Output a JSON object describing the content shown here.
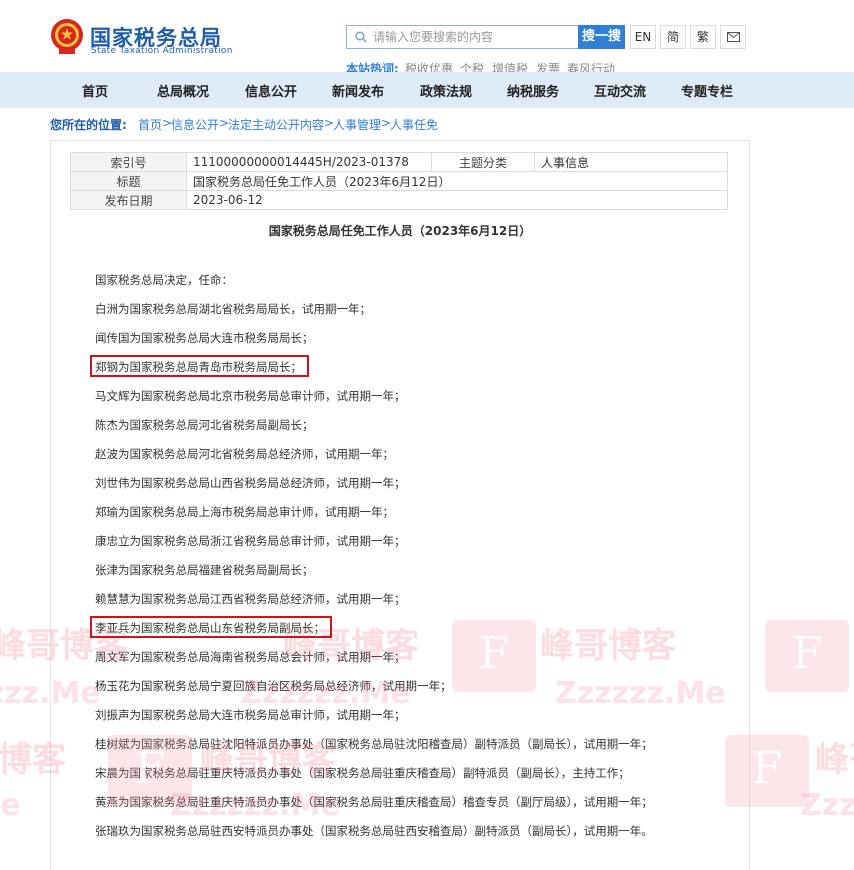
{
  "header": {
    "site_name_cn": "国家税务总局",
    "site_name_en": "State Taxation Administration",
    "search_placeholder": "请输入您要搜索的内容",
    "search_button": "搜一搜",
    "lang_buttons": [
      "EN",
      "简",
      "繁"
    ],
    "mail_icon": "mail-icon",
    "hot_label": "本站热词:",
    "hot_words": [
      "税收优惠",
      "个税",
      "增值税",
      "发票",
      "春风行动"
    ]
  },
  "nav": [
    "首页",
    "总局概况",
    "信息公开",
    "新闻发布",
    "政策法规",
    "纳税服务",
    "互动交流",
    "专题专栏"
  ],
  "breadcrumb": {
    "label": "您所在的位置:",
    "items": [
      "首页",
      "信息公开",
      "法定主动公开内容",
      "人事管理",
      "人事任免"
    ]
  },
  "meta": {
    "index_label": "索引号",
    "index_value": "11100000000014445H/2023-01378",
    "topic_label": "主题分类",
    "topic_value": "人事信息",
    "title_label": "标题",
    "title_value": "国家税务总局任免工作人员（2023年6月12日）",
    "date_label": "发布日期",
    "date_value": "2023-06-12"
  },
  "doc_title": "国家税务总局任免工作人员（2023年6月12日）",
  "paragraphs": [
    "国家税务总局决定，任命：",
    "白洲为国家税务总局湖北省税务局局长，试用期一年；",
    "闻传国为国家税务总局大连市税务局局长；",
    "郑钢为国家税务总局青岛市税务局局长；",
    "马文辉为国家税务总局北京市税务局总审计师，试用期一年；",
    "陈杰为国家税务总局河北省税务局副局长；",
    "赵波为国家税务总局河北省税务局总经济师，试用期一年；",
    "刘世伟为国家税务总局山西省税务局总经济师，试用期一年；",
    "郑瑜为国家税务总局上海市税务局总审计师，试用期一年；",
    "康忠立为国家税务总局浙江省税务局总审计师，试用期一年；",
    "张津为国家税务总局福建省税务局副局长；",
    "赖慧慧为国家税务总局江西省税务局总经济师，试用期一年；",
    "李亚兵为国家税务总局山东省税务局副局长；",
    "周文军为国家税务总局海南省税务局总会计师，试用期一年；",
    "杨玉花为国家税务总局宁夏回族自治区税务局总经济师，试用期一年；",
    "刘振声为国家税务总局大连市税务局总审计师，试用期一年；",
    "桂树斌为国家税务总局驻沈阳特派员办事处（国家税务总局驻沈阳稽查局）副特派员（副局长），试用期一年；",
    "宋晨为国家税务总局驻重庆特派员办事处（国家税务总局驻重庆稽查局）副特派员（副局长），主持工作；",
    "黄燕为国家税务总局驻重庆特派员办事处（国家税务总局驻重庆稽查局）稽查专员（副厅局级），试用期一年；",
    "张瑞玖为国家税务总局驻西安特派员办事处（国家税务总局驻西安稽查局）副特派员（副局长），试用期一年。"
  ],
  "highlighted_paragraphs": [
    3,
    12
  ],
  "watermark": {
    "text_cn": "峰哥博客",
    "text_en": "Zzzzzz.Me",
    "logo_letter": "F"
  },
  "colors": {
    "brand_blue": "#1f5da8",
    "nav_bg": "#dfeaf7",
    "highlight_red": "#c4161c"
  }
}
